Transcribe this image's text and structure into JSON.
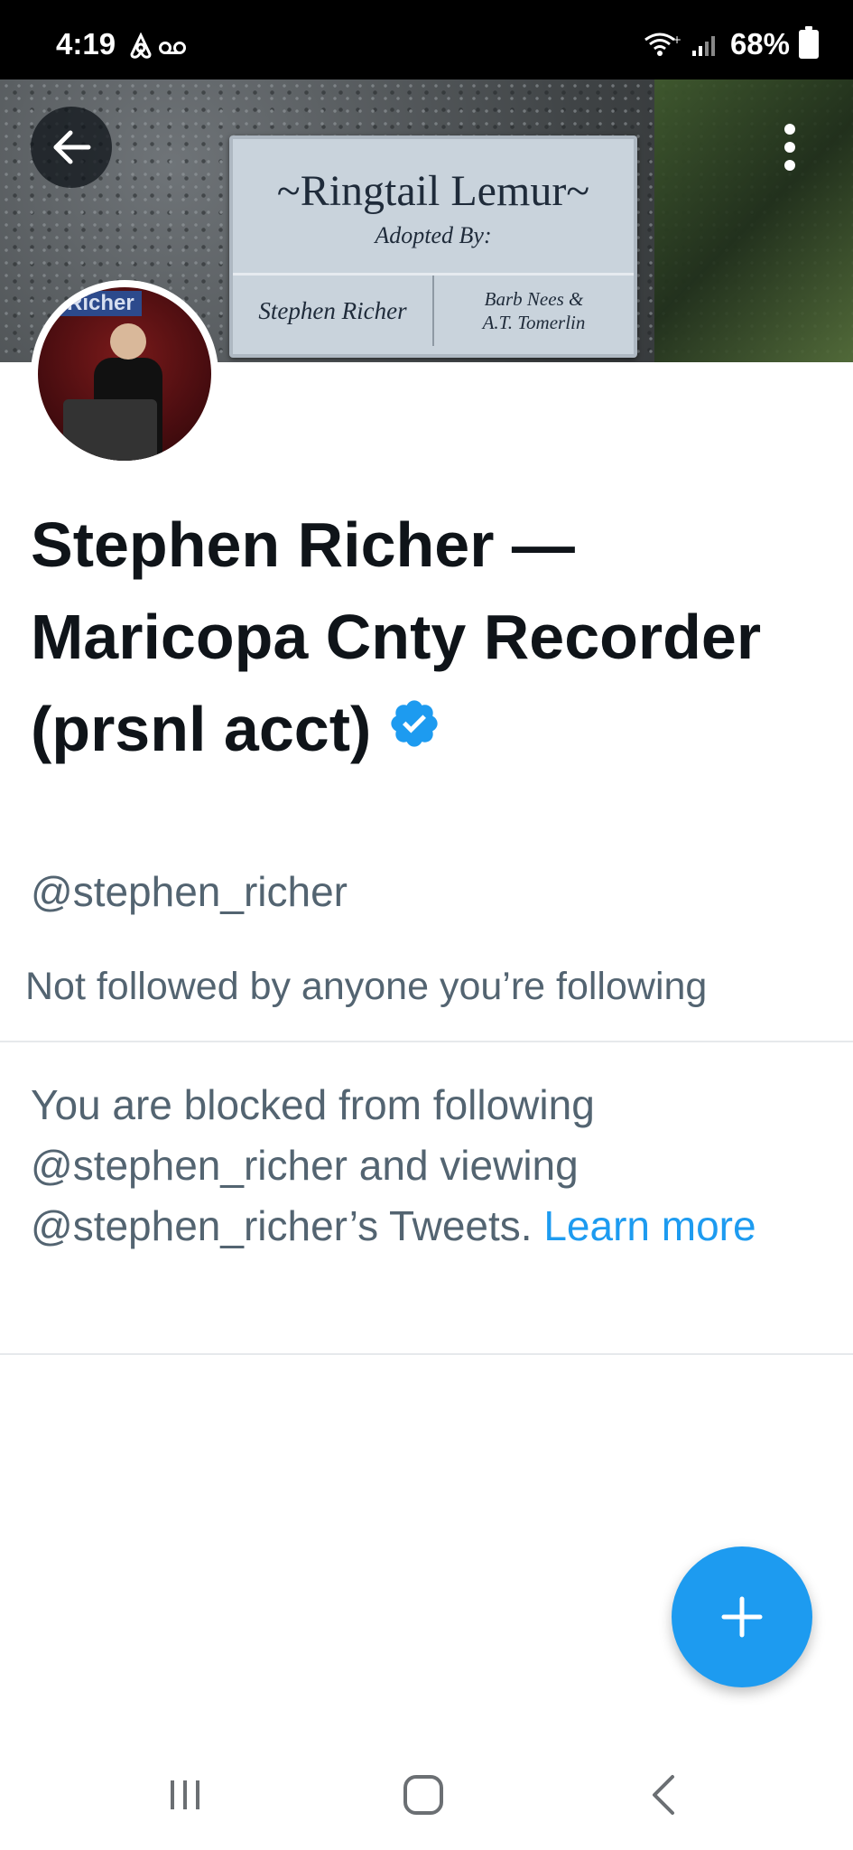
{
  "status_bar": {
    "time": "4:19",
    "battery": "68%",
    "icons": [
      "airbnb-icon",
      "voicemail-icon",
      "wifi-icon",
      "signal-icon",
      "battery-icon"
    ]
  },
  "banner": {
    "plaque_title": "~Ringtail Lemur~",
    "plaque_subtitle": "Adopted By:",
    "plaque_name_left": "Stephen Richer",
    "plaque_name_right_1": "Barb Nees &",
    "plaque_name_right_2": "A.T. Tomerlin"
  },
  "avatar": {
    "banner_text": "Richer"
  },
  "profile": {
    "display_name": "Stephen Richer —Maricopa Cnty Recorder (prsnl acct)",
    "handle": "@stephen_richer",
    "follow_note": "Not followed by anyone you’re following",
    "blocked_text": "You are blocked from following @stephen_richer and viewing @stephen_richer’s Tweets.",
    "learn_more": "Learn more"
  },
  "colors": {
    "accent": "#1d9bf0",
    "text_primary": "#0f1419",
    "text_secondary": "#536471"
  }
}
